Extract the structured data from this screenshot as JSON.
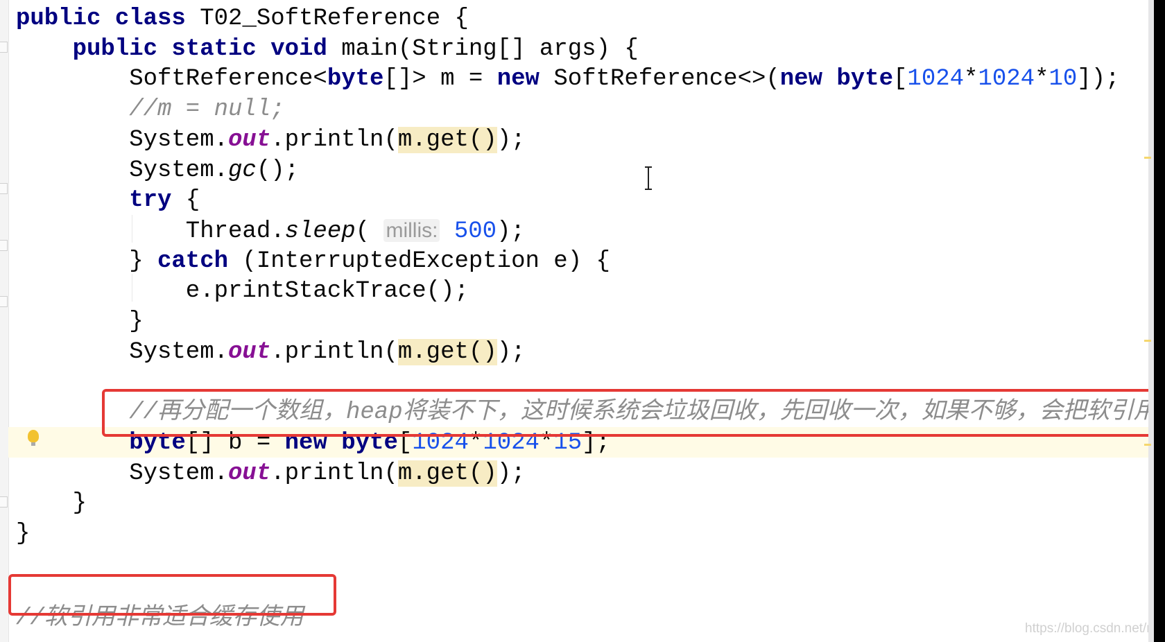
{
  "code_lines": [
    {
      "indent": 0,
      "tokens": [
        {
          "t": "public class ",
          "c": "kw"
        },
        {
          "t": "T02_SoftReference {",
          "c": ""
        }
      ]
    },
    {
      "indent": 4,
      "tokens": [
        {
          "t": "public static void ",
          "c": "kw"
        },
        {
          "t": "main(String[] args) {",
          "c": ""
        }
      ]
    },
    {
      "indent": 8,
      "tokens": [
        {
          "t": "SoftReference<",
          "c": ""
        },
        {
          "t": "byte",
          "c": "kw"
        },
        {
          "t": "[]> m = ",
          "c": ""
        },
        {
          "t": "new ",
          "c": "kw"
        },
        {
          "t": "SoftReference<>(",
          "c": ""
        },
        {
          "t": "new byte",
          "c": "kw"
        },
        {
          "t": "[",
          "c": ""
        },
        {
          "t": "1024",
          "c": "num"
        },
        {
          "t": "*",
          "c": ""
        },
        {
          "t": "1024",
          "c": "num"
        },
        {
          "t": "*",
          "c": ""
        },
        {
          "t": "10",
          "c": "num"
        },
        {
          "t": "]);",
          "c": ""
        }
      ]
    },
    {
      "indent": 8,
      "tokens": [
        {
          "t": "//m = null;",
          "c": "cm"
        }
      ]
    },
    {
      "indent": 8,
      "tokens": [
        {
          "t": "System.",
          "c": ""
        },
        {
          "t": "out",
          "c": "fld"
        },
        {
          "t": ".println(",
          "c": ""
        },
        {
          "t": "m.get()",
          "c": "hl"
        },
        {
          "t": ");",
          "c": ""
        }
      ]
    },
    {
      "indent": 8,
      "tokens": [
        {
          "t": "System.",
          "c": ""
        },
        {
          "t": "gc",
          "c": "it"
        },
        {
          "t": "();",
          "c": ""
        }
      ]
    },
    {
      "indent": 8,
      "tokens": [
        {
          "t": "try ",
          "c": "kw"
        },
        {
          "t": "{",
          "c": ""
        }
      ]
    },
    {
      "indent": 12,
      "tokens": [
        {
          "t": "Thread.",
          "c": ""
        },
        {
          "t": "sleep",
          "c": "it"
        },
        {
          "t": "( ",
          "c": ""
        },
        {
          "t": "millis:",
          "c": "hint"
        },
        {
          "t": " ",
          "c": ""
        },
        {
          "t": "500",
          "c": "num"
        },
        {
          "t": ");",
          "c": ""
        }
      ]
    },
    {
      "indent": 8,
      "tokens": [
        {
          "t": "} ",
          "c": ""
        },
        {
          "t": "catch ",
          "c": "kw"
        },
        {
          "t": "(InterruptedException e) {",
          "c": ""
        }
      ]
    },
    {
      "indent": 12,
      "tokens": [
        {
          "t": "e.printStackTrace();",
          "c": ""
        }
      ]
    },
    {
      "indent": 8,
      "tokens": [
        {
          "t": "}",
          "c": ""
        }
      ]
    },
    {
      "indent": 8,
      "tokens": [
        {
          "t": "System.",
          "c": ""
        },
        {
          "t": "out",
          "c": "fld"
        },
        {
          "t": ".println(",
          "c": ""
        },
        {
          "t": "m.get()",
          "c": "hl"
        },
        {
          "t": ");",
          "c": ""
        }
      ]
    },
    {
      "indent": 0,
      "tokens": []
    },
    {
      "indent": 8,
      "tokens": [
        {
          "t": "//再分配一个数组，heap将装不下，这时候系统会垃圾回收，先回收一次，如果不够，会把软引用干掉",
          "c": "cm"
        }
      ]
    },
    {
      "indent": 8,
      "tokens": [
        {
          "t": "byte",
          "c": "kw"
        },
        {
          "t": "[] b = ",
          "c": ""
        },
        {
          "t": "new byte",
          "c": "kw"
        },
        {
          "t": "[",
          "c": ""
        },
        {
          "t": "1024",
          "c": "num"
        },
        {
          "t": "*",
          "c": ""
        },
        {
          "t": "1024",
          "c": "num"
        },
        {
          "t": "*",
          "c": ""
        },
        {
          "t": "15",
          "c": "num"
        },
        {
          "t": "];",
          "c": ""
        }
      ]
    },
    {
      "indent": 8,
      "tokens": [
        {
          "t": "System.",
          "c": ""
        },
        {
          "t": "out",
          "c": "fld"
        },
        {
          "t": ".println(",
          "c": ""
        },
        {
          "t": "m.get()",
          "c": "hl"
        },
        {
          "t": ");",
          "c": ""
        }
      ]
    },
    {
      "indent": 4,
      "tokens": [
        {
          "t": "}",
          "c": ""
        }
      ]
    },
    {
      "indent": 0,
      "tokens": [
        {
          "t": "}",
          "c": ""
        }
      ]
    },
    {
      "indent": 0,
      "tokens": []
    },
    {
      "indent": 0,
      "tokens": [
        {
          "t": "//软引用非常适合缓存使用",
          "c": "cm"
        }
      ]
    }
  ],
  "watermark": "https://blog.csdn.net/nikyae",
  "colors": {
    "annotation_box": "#e53935",
    "keyword": "#000080",
    "number": "#1750eb",
    "comment": "#8c8c8c",
    "static_field": "#871094"
  },
  "icons": {
    "gutter": "lightbulb-icon",
    "cursor": "text-cursor-icon"
  }
}
